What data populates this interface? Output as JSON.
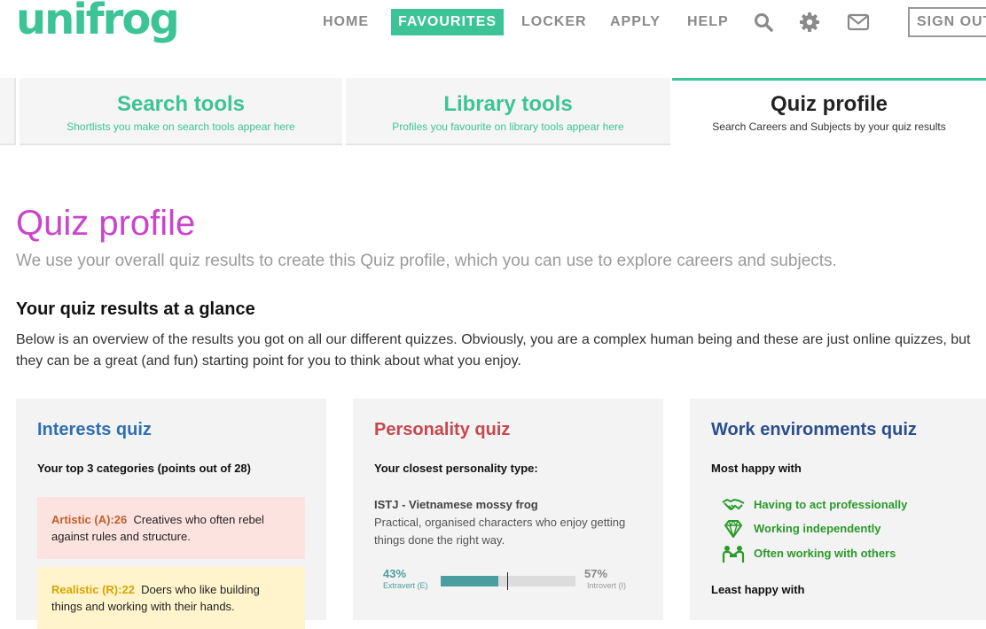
{
  "header": {
    "logo": "unifrog",
    "nav": [
      {
        "label": "HOME",
        "active": false
      },
      {
        "label": "FAVOURITES",
        "active": true
      },
      {
        "label": "LOCKER",
        "active": false
      },
      {
        "label": "APPLY",
        "active": false
      },
      {
        "label": "HELP",
        "active": false
      }
    ],
    "icons": [
      "search-icon",
      "gear-icon",
      "mail-icon"
    ],
    "signout_label": "SIGN OUT"
  },
  "tabs": [
    {
      "title": "Search tools",
      "subtitle": "Shortlists you make on search tools appear here",
      "active": false
    },
    {
      "title": "Library tools",
      "subtitle": "Profiles you favourite on library tools appear here",
      "active": false
    },
    {
      "title": "Quiz profile",
      "subtitle": "Search Careers and Subjects by your quiz results",
      "active": true
    }
  ],
  "page": {
    "title": "Quiz profile",
    "subtitle": "We use your overall quiz results to create this Quiz profile, which you can use to explore careers and subjects.",
    "section_heading": "Your quiz results at a glance",
    "section_desc": "Below is an overview of the results you got on all our different quizzes. Obviously, you are a complex human being and these are just online quizzes, but they can be a great (and fun) starting point for you to think about what you enjoy."
  },
  "interests_card": {
    "title": "Interests quiz",
    "title_color": "#2f6fb0",
    "label": "Your top 3 categories (points out of 28)",
    "categories": [
      {
        "name": "Artistic (A):26",
        "desc": "Creatives who often rebel against rules and structure.",
        "bg": "#fde3df",
        "name_color": "#c0602a"
      },
      {
        "name": "Realistic (R):22",
        "desc": "Doers who like building things and working with their hands.",
        "bg": "#fff4cc",
        "name_color": "#d9a400"
      }
    ]
  },
  "personality_card": {
    "title": "Personality quiz",
    "title_color": "#c8474f",
    "label": "Your closest personality type:",
    "type_name": "ISTJ - Vietnamese mossy frog",
    "type_desc": "Practical, organised characters who enjoy getting things done the right way.",
    "scale": {
      "left_pct": "43%",
      "left_label": "Extravert (E)",
      "right_pct": "57%",
      "right_label": "Introvert (I)",
      "left_value": 43,
      "right_value": 57
    }
  },
  "work_card": {
    "title": "Work environments quiz",
    "title_color": "#2b4e8c",
    "most_label": "Most happy with",
    "most_items": [
      {
        "icon": "handshake-icon",
        "text": "Having to act professionally"
      },
      {
        "icon": "diamond-icon",
        "text": "Working independently"
      },
      {
        "icon": "people-icon",
        "text": "Often working with others"
      }
    ],
    "least_label": "Least happy with",
    "accent": "#2a9a2a"
  },
  "colors": {
    "brand": "#3cc497",
    "title_pink": "#cc44cc",
    "scale_teal": "#4b9ea0"
  }
}
